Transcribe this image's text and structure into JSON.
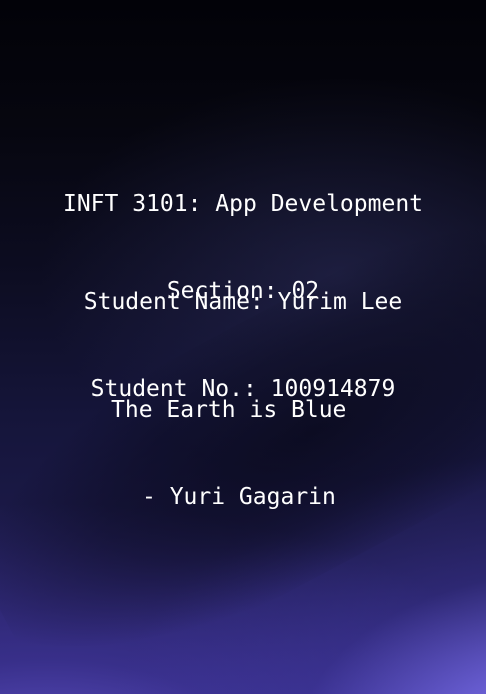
{
  "course": {
    "title": "INFT 3101: App Development",
    "section": "Section: 02"
  },
  "student": {
    "name_line": "Student Name: Yurim Lee",
    "number_line": "Student No.: 100914879"
  },
  "quote": {
    "text": "The Earth is Blue",
    "attribution": "- Yuri Gagarin"
  },
  "colors": {
    "text": "#ffffff",
    "background_top": "#020208",
    "background_bottom_accent": "#9c8eff"
  }
}
